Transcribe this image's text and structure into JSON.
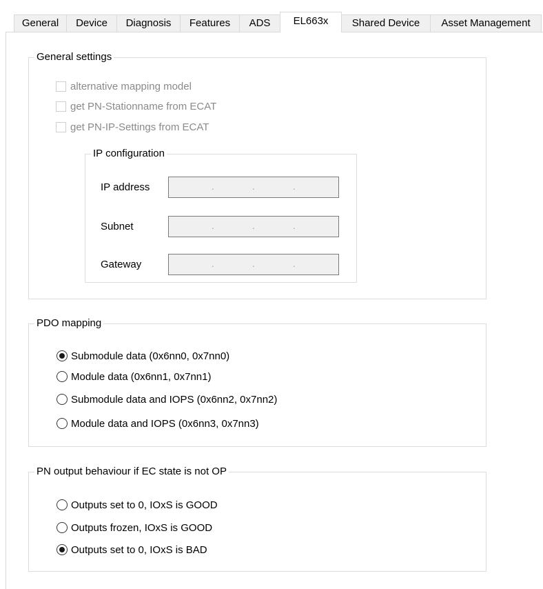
{
  "tabs": [
    {
      "label": "General",
      "active": false
    },
    {
      "label": "Device",
      "active": false
    },
    {
      "label": "Diagnosis",
      "active": false
    },
    {
      "label": "Features",
      "active": false
    },
    {
      "label": "ADS",
      "active": false
    },
    {
      "label": "EL663x",
      "active": true
    },
    {
      "label": "Shared Device",
      "active": false
    },
    {
      "label": "Asset Management",
      "active": false
    }
  ],
  "general_settings": {
    "title": "General settings",
    "checkboxes": [
      {
        "label": "alternative mapping model",
        "checked": false,
        "enabled": false
      },
      {
        "label": "get PN-Stationname from ECAT",
        "checked": false,
        "enabled": false
      },
      {
        "label": "get PN-IP-Settings from ECAT",
        "checked": false,
        "enabled": false
      }
    ],
    "ip_configuration": {
      "title": "IP configuration",
      "fields": [
        {
          "label": "IP address",
          "value": "",
          "separator": "."
        },
        {
          "label": "Subnet",
          "value": "",
          "separator": "."
        },
        {
          "label": "Gateway",
          "value": "",
          "separator": "."
        }
      ]
    }
  },
  "pdo_mapping": {
    "title": "PDO mapping",
    "options": [
      {
        "label": "Submodule data (0x6nn0, 0x7nn0)",
        "selected": true
      },
      {
        "label": "Module data (0x6nn1, 0x7nn1)",
        "selected": false
      },
      {
        "label": "Submodule data and IOPS (0x6nn2, 0x7nn2)",
        "selected": false
      },
      {
        "label": "Module data and IOPS (0x6nn3, 0x7nn3)",
        "selected": false
      }
    ]
  },
  "pn_output": {
    "title": "PN output behaviour if EC state is not OP",
    "options": [
      {
        "label": "Outputs set to 0, IOxS is GOOD",
        "selected": false
      },
      {
        "label": "Outputs frozen, IOxS is GOOD",
        "selected": false
      },
      {
        "label": "Outputs set to 0, IOxS is BAD",
        "selected": true
      }
    ]
  }
}
